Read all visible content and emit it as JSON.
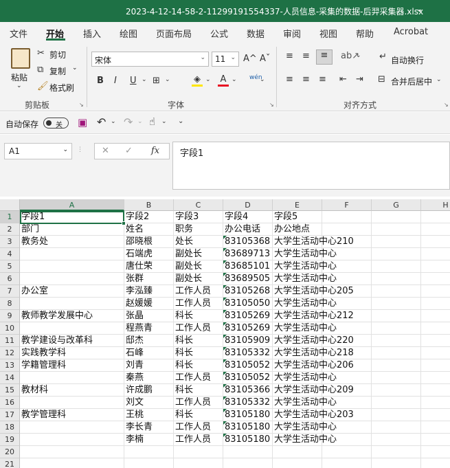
{
  "window": {
    "title": "2023-4-12-14-58-2-11299191554337-人员信息-采集的数据-后羿采集器.xlsx",
    "title_chevron": "⌄"
  },
  "ribbon_tabs": [
    "文件",
    "开始",
    "插入",
    "绘图",
    "页面布局",
    "公式",
    "数据",
    "审阅",
    "视图",
    "帮助",
    "Acrobat"
  ],
  "clipboard": {
    "paste": "粘贴",
    "cut": "剪切",
    "copy": "复制",
    "format_painter": "格式刷",
    "group": "剪贴板"
  },
  "font": {
    "name": "宋体",
    "size": "11",
    "group": "字体",
    "bold": "B",
    "italic": "I",
    "underline": "U",
    "grow": "A^",
    "shrink": "Aˇ",
    "wen": "wén"
  },
  "alignment": {
    "wrap_text": "自动换行",
    "merge_center": "合并后居中",
    "group": "对齐方式"
  },
  "qat": {
    "autosave_label": "自动保存",
    "autosave_state": "关"
  },
  "formula_bar": {
    "name_box": "A1",
    "fx": "fx",
    "content": "字段1"
  },
  "columns": [
    "A",
    "B",
    "C",
    "D",
    "E",
    "F",
    "G",
    "H"
  ],
  "rows": [
    [
      "字段1",
      "字段2",
      "字段3",
      "字段4",
      "字段5"
    ],
    [
      "部门",
      "姓名",
      "职务",
      "办公电话",
      "办公地点"
    ],
    [
      "教务处",
      "邵晓根",
      "处长",
      "83105368",
      "大学生活动中心210"
    ],
    [
      "",
      "石端虎",
      "副处长",
      "83689713",
      "大学生活动中心"
    ],
    [
      "",
      "唐仕荣",
      "副处长",
      "83685101",
      "大学生活动中心"
    ],
    [
      "",
      "张群",
      "副处长",
      "83689505",
      "大学生活动中心"
    ],
    [
      "办公室",
      "李泓臻",
      "工作人员",
      "83105268",
      "大学生活动中心205"
    ],
    [
      "",
      "赵媛媛",
      "工作人员",
      "83105050",
      "大学生活动中心"
    ],
    [
      "教师教学发展中心",
      "张晶",
      "科长",
      "83105269",
      "大学生活动中心212"
    ],
    [
      "",
      "程燕青",
      "工作人员",
      "83105269",
      "大学生活动中心"
    ],
    [
      "教学建设与改革科",
      "邸杰",
      "科长",
      "83105909",
      "大学生活动中心220"
    ],
    [
      "实践教学科",
      "石峰",
      "科长",
      "83105332",
      "大学生活动中心218"
    ],
    [
      "学籍管理科",
      "刘青",
      "科长",
      "83105052",
      "大学生活动中心206"
    ],
    [
      "",
      "秦燕",
      "工作人员",
      "83105052",
      "大学生活动中心"
    ],
    [
      "教材科",
      "许成鹏",
      "科长",
      "83105366",
      "大学生活动中心209"
    ],
    [
      "",
      "刘文",
      "工作人员",
      "83105332",
      "大学生活动中心"
    ],
    [
      "教学管理科",
      "王桃",
      "科长",
      "83105180",
      "大学生活动中心203"
    ],
    [
      "",
      "李长青",
      "工作人员",
      "83105180",
      "大学生活动中心"
    ],
    [
      "",
      "李楠",
      "工作人员",
      "83105180",
      "大学生活动中心"
    ],
    [
      "",
      "",
      "",
      "",
      ""
    ],
    [
      "",
      "",
      "",
      "",
      ""
    ]
  ],
  "row_numbers": [
    "1",
    "2",
    "3",
    "4",
    "5",
    "6",
    "7",
    "8",
    "9",
    "10",
    "11",
    "12",
    "13",
    "14",
    "15",
    "16",
    "17",
    "18",
    "19",
    "20",
    "21"
  ],
  "cell_layout_note": ""
}
